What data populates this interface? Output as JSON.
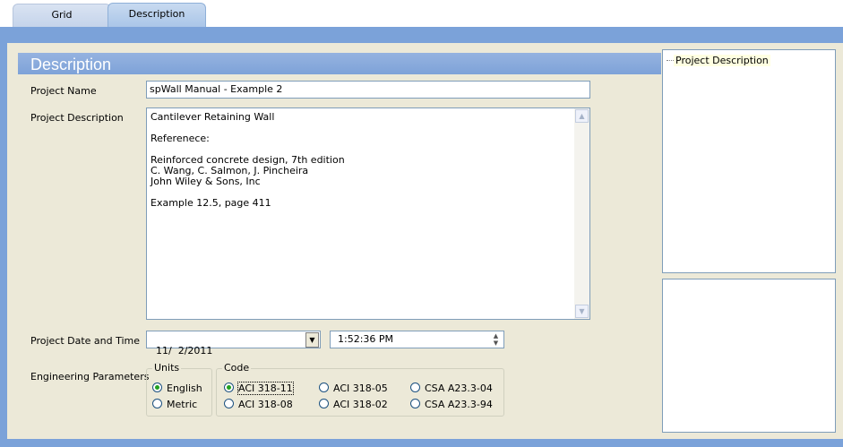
{
  "tabs": [
    {
      "label": "Grid",
      "active": false
    },
    {
      "label": "Description",
      "active": true
    }
  ],
  "header": {
    "title": "Description"
  },
  "fields": {
    "project_name_label": "Project Name",
    "project_name_value": "spWall Manual - Example 2",
    "project_description_label": "Project Description",
    "project_description_value": "Cantilever Retaining Wall\n\nReferenece:\n\nReinforced concrete design, 7th edition\nC. Wang, C. Salmon, J. Pincheira\nJohn Wiley & Sons, Inc\n\nExample 12.5, page 411",
    "date_time_label": "Project Date and Time",
    "date_value": "11/  2/2011",
    "time_value": "1:52:36 PM",
    "engineering_label": "Engineering Parameters"
  },
  "units": {
    "title": "Units",
    "options": [
      {
        "label": "English",
        "selected": true
      },
      {
        "label": "Metric",
        "selected": false
      }
    ]
  },
  "code": {
    "title": "Code",
    "options": [
      {
        "label": "ACI 318-11",
        "selected": true
      },
      {
        "label": "ACI 318-05",
        "selected": false
      },
      {
        "label": "CSA A23.3-04",
        "selected": false
      },
      {
        "label": "ACI 318-08",
        "selected": false
      },
      {
        "label": "ACI 318-02",
        "selected": false
      },
      {
        "label": "CSA A23.3-94",
        "selected": false
      }
    ]
  },
  "tree": {
    "items": [
      {
        "label": "Project Description"
      }
    ]
  },
  "colors": {
    "frame": "#7ba2d9",
    "panel": "#ece9d8",
    "header": "#8aabdd"
  },
  "icons": {
    "dropdown": "chevron-down-icon",
    "spinner": "spin-updown-icon",
    "scroll_up": "scroll-up-icon",
    "scroll_down": "scroll-down-icon"
  }
}
